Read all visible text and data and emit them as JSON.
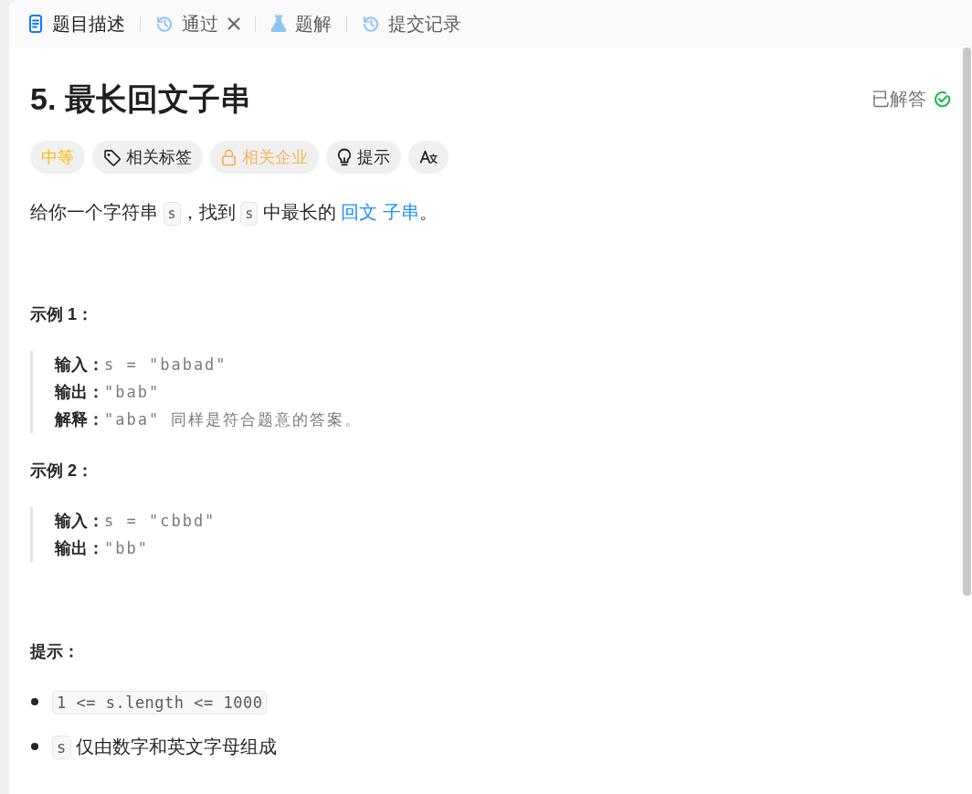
{
  "tabs": [
    {
      "kind": "description",
      "label": "题目描述",
      "selected": true,
      "closable": false
    },
    {
      "kind": "history",
      "label": "通过",
      "selected": false,
      "closable": true
    },
    {
      "kind": "solutions",
      "label": "题解",
      "selected": false,
      "closable": false
    },
    {
      "kind": "history",
      "label": "提交记录",
      "selected": false,
      "closable": false
    }
  ],
  "problem": {
    "title": "5. 最长回文子串",
    "status": "已解答",
    "solved": true
  },
  "tags": [
    {
      "kind": "difficulty",
      "label": "中等"
    },
    {
      "kind": "topics",
      "label": "相关标签"
    },
    {
      "kind": "companies",
      "label": "相关企业"
    },
    {
      "kind": "hint",
      "label": "提示"
    },
    {
      "kind": "translate"
    }
  ],
  "description": [
    {
      "kind": "text",
      "text": "给你一个字符串 "
    },
    {
      "kind": "code",
      "text": "s"
    },
    {
      "kind": "text",
      "text": "，找到 "
    },
    {
      "kind": "code",
      "text": "s"
    },
    {
      "kind": "text",
      "text": " 中最长的 "
    },
    {
      "kind": "link",
      "text": "回文"
    },
    {
      "kind": "link",
      "text": "子串"
    },
    {
      "kind": "text",
      "text": "。"
    }
  ],
  "examples": [
    {
      "heading": "示例 1：",
      "lines": [
        {
          "label": "输入：",
          "value": "s = \"babad\""
        },
        {
          "label": "输出：",
          "value": "\"bab\""
        },
        {
          "label": "解释：",
          "value": "\"aba\" 同样是符合题意的答案。"
        }
      ]
    },
    {
      "heading": "示例 2：",
      "lines": [
        {
          "label": "输入：",
          "value": "s = \"cbbd\""
        },
        {
          "label": "输出：",
          "value": "\"bb\""
        }
      ]
    }
  ],
  "constraints": {
    "heading": "提示：",
    "items": [
      [
        {
          "kind": "code",
          "text": "1 <= s.length <= 1000"
        }
      ],
      [
        {
          "kind": "code",
          "text": "s"
        },
        {
          "kind": "text",
          "text": " 仅由数字和英文字母组成"
        }
      ]
    ]
  }
}
